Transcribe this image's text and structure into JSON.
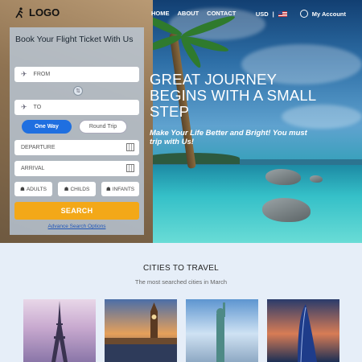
{
  "nav": {
    "logo": "LOGO",
    "menu": [
      "HOME",
      "ABOUT",
      "CONTACT"
    ],
    "currency": "USD",
    "account": "My Account"
  },
  "booking": {
    "title": "Book Your Flight Ticket With Us",
    "from_placeholder": "FROM",
    "to_placeholder": "TO",
    "trip_types": [
      "One Way",
      "Round Trip"
    ],
    "selected_trip": "One Way",
    "departure_placeholder": "DEPARTURE",
    "arrival_placeholder": "ARRIVAL",
    "passengers": [
      "ADULTS",
      "CHILDS",
      "INFANTS"
    ],
    "search_label": "SEARCH",
    "advanced_link": "Advance Search Options"
  },
  "hero": {
    "headline": "GREAT JOURNEY BEGINS WITH A SMALL STEP",
    "subline": "Make Your Life Better and Bright!  You must trip with Us!"
  },
  "cities": {
    "title": "CITIES TO TRAVEL",
    "subtitle": "The most searched cities in March"
  },
  "colors": {
    "accent_blue": "#1f6fe0",
    "search_orange": "#f3a818",
    "link_blue": "#1f55b8"
  }
}
